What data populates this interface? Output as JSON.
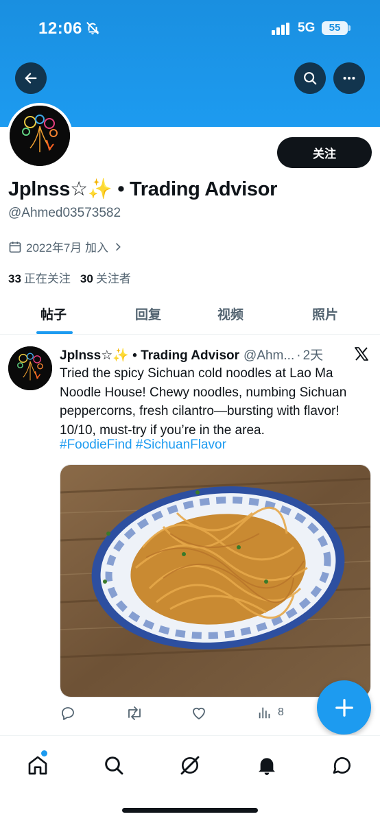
{
  "status_bar": {
    "time": "12:06",
    "network": "5G",
    "battery": "55"
  },
  "header": {
    "back_icon": "arrow-left-icon",
    "search_icon": "search-icon",
    "more_icon": "more-horizontal-icon",
    "banner_color": "#1d9bf0"
  },
  "profile": {
    "display_name": "Jplnss☆✨ • Trading Advisor",
    "handle": "@Ahmed03573582",
    "joined": "2022年7月 加入",
    "following_count": "33",
    "following_label": "正在关注",
    "followers_count": "30",
    "followers_label": "关注者",
    "follow_label": "关注"
  },
  "tabs": [
    {
      "label": "帖子",
      "active": true
    },
    {
      "label": "回复",
      "active": false
    },
    {
      "label": "视频",
      "active": false
    },
    {
      "label": "照片",
      "active": false
    }
  ],
  "post": {
    "author_name": "Jplnss☆✨ • Trading Advisor",
    "author_handle": "@Ahm...",
    "separator": "·",
    "time": "2天",
    "text": "Tried the spicy Sichuan cold noodles at Lao Ma Noodle House! Chewy noodles, numbing Sichuan peppercorns, fresh cilantro—bursting with flavor! 10/10, must-try if you’re in the area.",
    "hashtags": "#FoodieFind #SichuanFlavor",
    "views": "8"
  },
  "bottom_nav": [
    {
      "icon": "home-icon"
    },
    {
      "icon": "search-icon"
    },
    {
      "icon": "grok-icon"
    },
    {
      "icon": "bell-icon"
    },
    {
      "icon": "message-icon"
    }
  ],
  "colors": {
    "accent": "#1d9bf0",
    "text": "#0f1419",
    "secondary": "#536471"
  }
}
